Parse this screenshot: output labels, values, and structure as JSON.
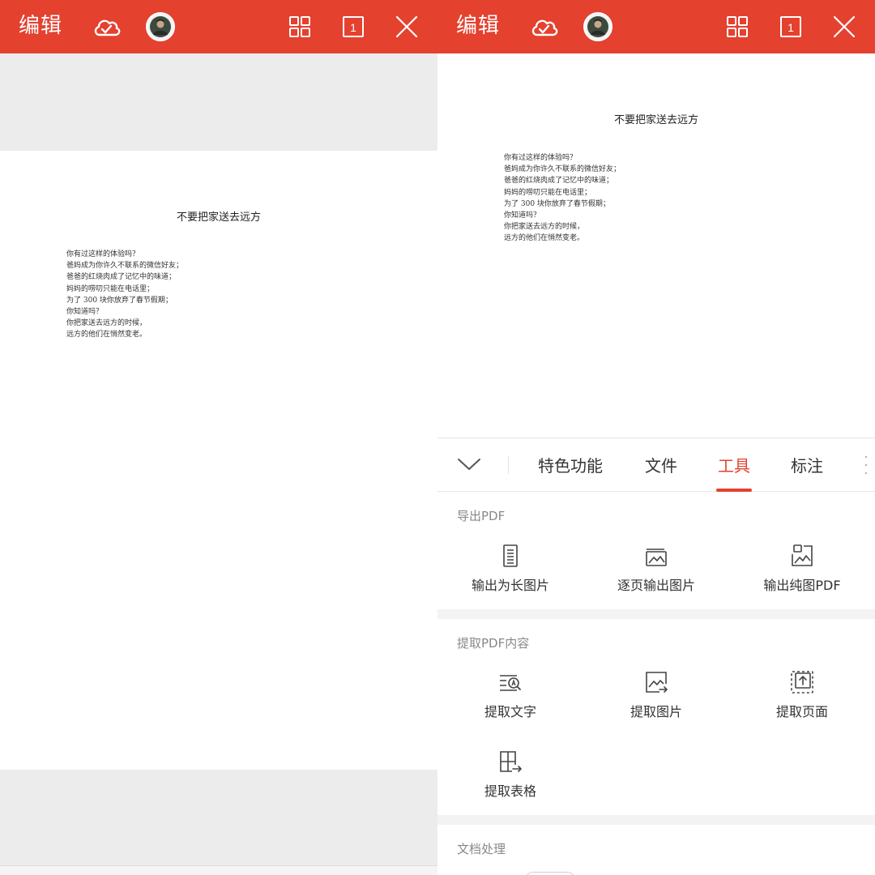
{
  "topbar": {
    "edit_label": "编辑",
    "accent_color": "#e4412f",
    "page_indicator": "1",
    "icons": [
      "cloud-check-icon",
      "avatar",
      "grid-icon",
      "page-count-icon",
      "close-icon"
    ]
  },
  "document": {
    "title": "不要把家送去远方",
    "lines": [
      "你有过这样的体验吗？",
      "爸妈成为你许久不联系的微信好友；",
      "爸爸的红烧肉成了记忆中的味道；",
      "妈妈的唠叨只能在电话里；",
      "为了 300 块你放弃了春节假期；",
      "你知道吗？",
      "你把家送去远方的时候，",
      "远方的他们在悄然变老。"
    ]
  },
  "panel": {
    "tabs": [
      "特色功能",
      "文件",
      "工具",
      "标注"
    ],
    "active_tab": "工具",
    "sections": [
      {
        "title": "导出PDF",
        "items": [
          {
            "label": "输出为长图片",
            "icon": "long-image-icon"
          },
          {
            "label": "逐页输出图片",
            "icon": "page-images-icon"
          },
          {
            "label": "输出纯图PDF",
            "icon": "image-pdf-icon"
          }
        ]
      },
      {
        "title": "提取PDF内容",
        "items": [
          {
            "label": "提取文字",
            "icon": "extract-text-icon"
          },
          {
            "label": "提取图片",
            "icon": "extract-image-icon"
          },
          {
            "label": "提取页面",
            "icon": "extract-page-icon"
          },
          {
            "label": "提取表格",
            "icon": "extract-table-icon"
          }
        ]
      },
      {
        "title": "文档处理",
        "items": []
      }
    ]
  }
}
